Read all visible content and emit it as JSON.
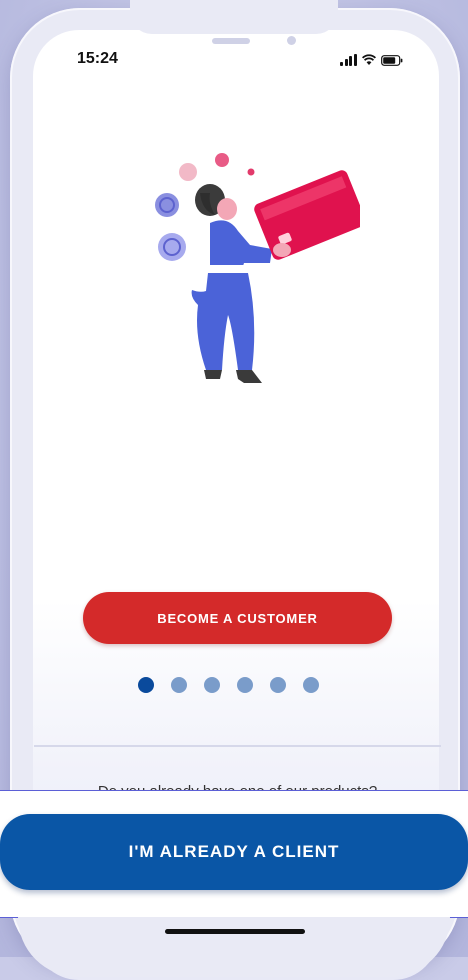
{
  "status_bar": {
    "time": "15:24"
  },
  "onboarding": {
    "primary_button": "BECOME A CUSTOMER",
    "page_count": 6,
    "active_page": 1,
    "question_text": "Do you already have one of our products?"
  },
  "footer": {
    "client_button": "I'M ALREADY A CLIENT"
  },
  "colors": {
    "primary_red": "#d42a2a",
    "brand_blue": "#0a56a6",
    "dot_active": "#0a4a9c",
    "dot_inactive": "#7a9cca"
  },
  "icons": [
    "signal-icon",
    "wifi-icon",
    "battery-icon"
  ]
}
